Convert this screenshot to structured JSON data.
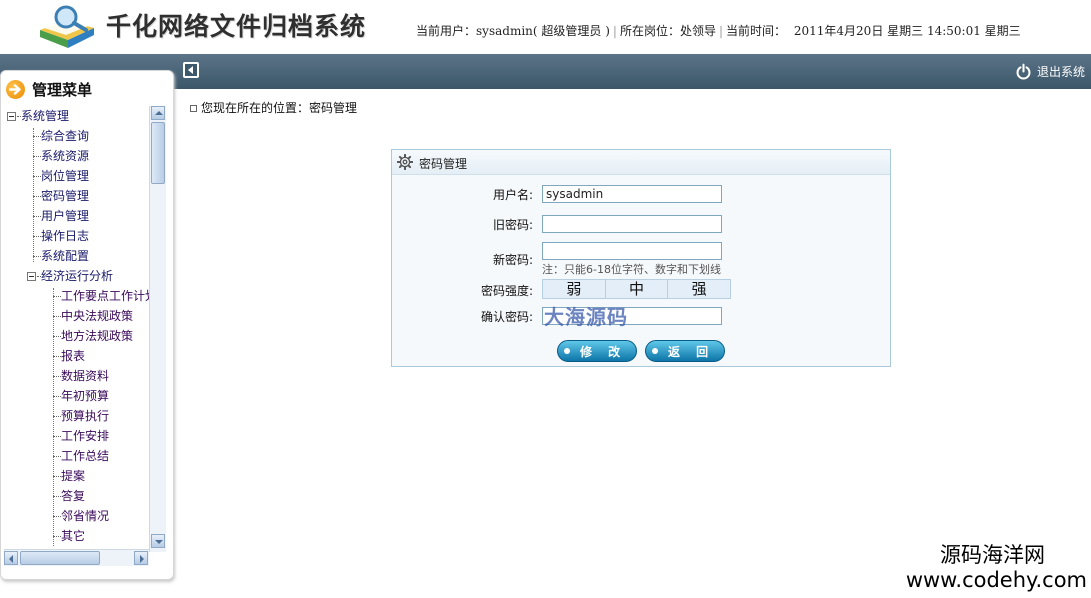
{
  "header": {
    "app_title": "千化网络文件归档系统",
    "current_user_label": "当前用户：",
    "current_user": "sysadmin",
    "role": "( 超级管理员  )",
    "position_label": "所在岗位：",
    "position": "处领导",
    "time_label": "当前时间：",
    "datetime": "2011年4月20日  星期三  14:50:01 星期三"
  },
  "topbar": {
    "logout_label": "退出系统"
  },
  "sidebar": {
    "title": "管理菜单",
    "tree": {
      "root": "系统管理",
      "items": [
        "综合查询",
        "系统资源",
        "岗位管理",
        "密码管理",
        "用户管理",
        "操作日志",
        "系统配置"
      ],
      "group": "经济运行分析",
      "subitems": [
        "工作要点工作计划",
        "中央法规政策",
        "地方法规政策",
        "报表",
        "数据资料",
        "年初预算",
        "预算执行",
        "工作安排",
        "工作总结",
        "提案",
        "答复",
        "邻省情况",
        "其它"
      ],
      "selected": "密码管理"
    }
  },
  "breadcrumb": {
    "text": "您现在所在的位置：密码管理"
  },
  "panel": {
    "title": "密码管理",
    "username_label": "用户名:",
    "username_value": "sysadmin",
    "old_password_label": "旧密码:",
    "new_password_label": "新密码:",
    "password_note": "注：只能6-18位字符、数字和下划线",
    "strength_label": "密码强度:",
    "strength_levels": [
      "弱",
      "中",
      "强"
    ],
    "confirm_label": "确认密码:",
    "confirm_watermark": "大海源码",
    "modify_button": "修 改",
    "back_button": "返 回"
  },
  "corner_watermark": {
    "cn": "源码海洋网",
    "url": "www.codehy.com"
  },
  "colors": {
    "topbar": "#3b5669",
    "button": "#0e76a8",
    "panel_border": "#a9c9dc",
    "menu_text": "#1a1a6a"
  }
}
